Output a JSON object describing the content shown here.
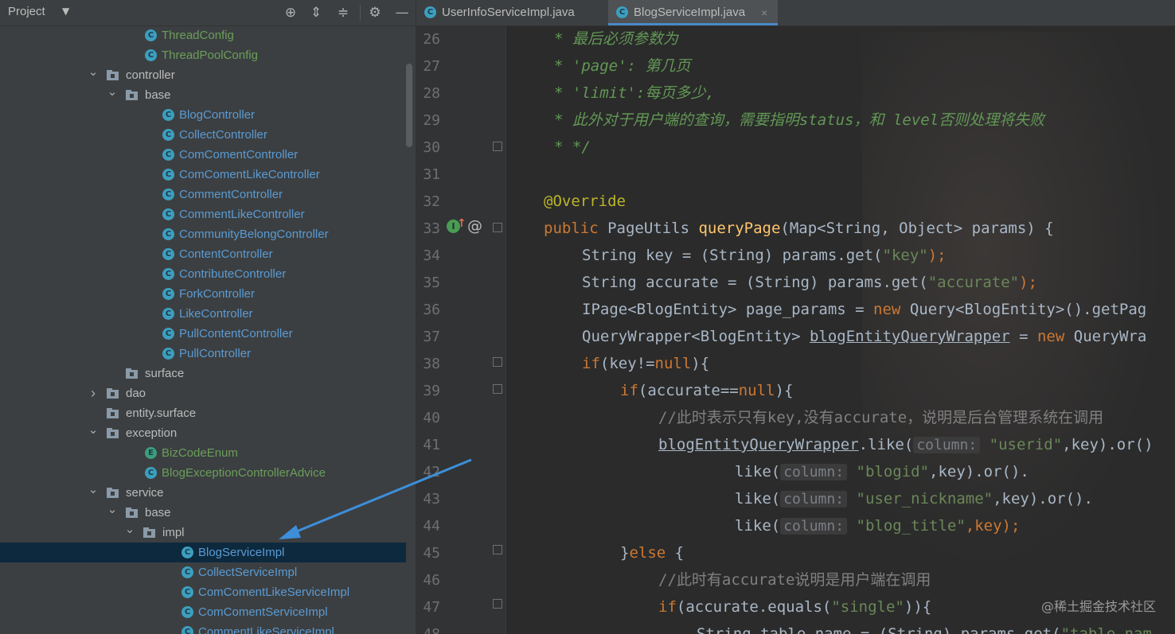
{
  "project_panel": {
    "title": "Project",
    "toolbar_icons": [
      "locate-icon",
      "expand-all-icon",
      "collapse-all-icon",
      "gear-icon",
      "minimize-icon"
    ],
    "tree": [
      {
        "label": "ThreadConfig",
        "kind": "class",
        "depth": 3
      },
      {
        "label": "ThreadPoolConfig",
        "kind": "class",
        "depth": 3
      },
      {
        "label": "controller",
        "kind": "folder",
        "depth": 2,
        "expanded": true
      },
      {
        "label": "base",
        "kind": "folder",
        "depth": 3,
        "expanded": true
      },
      {
        "label": "BlogController",
        "kind": "class",
        "depth": 4
      },
      {
        "label": "CollectController",
        "kind": "class",
        "depth": 4
      },
      {
        "label": "ComComentController",
        "kind": "class",
        "depth": 4
      },
      {
        "label": "ComComentLikeController",
        "kind": "class",
        "depth": 4
      },
      {
        "label": "CommentController",
        "kind": "class",
        "depth": 4
      },
      {
        "label": "CommentLikeController",
        "kind": "class",
        "depth": 4
      },
      {
        "label": "CommunityBelongController",
        "kind": "class",
        "depth": 4
      },
      {
        "label": "ContentController",
        "kind": "class",
        "depth": 4
      },
      {
        "label": "ContributeController",
        "kind": "class",
        "depth": 4
      },
      {
        "label": "ForkController",
        "kind": "class",
        "depth": 4
      },
      {
        "label": "LikeController",
        "kind": "class",
        "depth": 4
      },
      {
        "label": "PullContentController",
        "kind": "class",
        "depth": 4
      },
      {
        "label": "PullController",
        "kind": "class",
        "depth": 4
      },
      {
        "label": "surface",
        "kind": "folder",
        "depth": 3
      },
      {
        "label": "dao",
        "kind": "folder",
        "depth": 2,
        "expanded": false
      },
      {
        "label": "entity.surface",
        "kind": "folder",
        "depth": 2
      },
      {
        "label": "exception",
        "kind": "folder",
        "depth": 2,
        "expanded": true
      },
      {
        "label": "BizCodeEnum",
        "kind": "enum",
        "depth": 3
      },
      {
        "label": "BlogExceptionControllerAdvice",
        "kind": "class",
        "depth": 3
      },
      {
        "label": "service",
        "kind": "folder",
        "depth": 2,
        "expanded": true
      },
      {
        "label": "base",
        "kind": "folder",
        "depth": 3,
        "expanded": true
      },
      {
        "label": "impl",
        "kind": "folder",
        "depth": 4,
        "expanded": true
      },
      {
        "label": "BlogServiceImpl",
        "kind": "class",
        "depth": 5,
        "selected": true
      },
      {
        "label": "CollectServiceImpl",
        "kind": "class",
        "depth": 5
      },
      {
        "label": "ComComentLikeServiceImpl",
        "kind": "class",
        "depth": 5
      },
      {
        "label": "ComComentServiceImpl",
        "kind": "class",
        "depth": 5
      },
      {
        "label": "CommentLikeServiceImpl",
        "kind": "class",
        "depth": 5
      }
    ]
  },
  "editor": {
    "tabs": [
      {
        "label": "UserInfoServiceImpl.java",
        "active": false
      },
      {
        "label": "BlogServiceImpl.java",
        "active": true
      }
    ],
    "line_numbers": [
      "26",
      "27",
      "28",
      "29",
      "30",
      "31",
      "32",
      "33",
      "34",
      "35",
      "36",
      "37",
      "38",
      "39",
      "40",
      "41",
      "42",
      "43",
      "44",
      "45",
      "46",
      "47",
      "48"
    ],
    "code": {
      "l26": "* 最后必须参数为",
      "l27": "* 'page': 第几页",
      "l28": "* 'limit':每页多少,",
      "l29": "* 此外对于用户端的查询，需要指明status，和 level否则处理将失败",
      "l30": "* */",
      "l32": "@Override",
      "l33a": "public ",
      "l33b": "PageUtils ",
      "l33c": "queryPage",
      "l33d": "(Map<String, Object> params) {",
      "l34a": "String key = (String) params.get(",
      "l34b": "\"key\"",
      "l34c": ");",
      "l35a": "String accurate = (String) params.get(",
      "l35b": "\"accurate\"",
      "l35c": ");",
      "l36a": "IPage<BlogEntity> page_params = ",
      "l36b": "new ",
      "l36c": "Query<BlogEntity>().getPag",
      "l37a": "QueryWrapper<BlogEntity> ",
      "l37b": "blogEntityQueryWrapper",
      "l37c": " = ",
      "l37d": "new ",
      "l37e": "QueryWra",
      "l38a": "if",
      "l38b": "(key!=",
      "l38c": "null",
      "l38d": "){",
      "l39a": "if",
      "l39b": "(accurate==",
      "l39c": "null",
      "l39d": "){",
      "l40": "//此时表示只有key,没有accurate，说明是后台管理系统在调用",
      "l41a": "blogEntityQueryWrapper",
      "l41b": ".like(",
      "l41c": "column:",
      "l41d": "\"userid\"",
      "l41e": ",key).or()",
      "l42a": "like(",
      "l42b": "column:",
      "l42c": "\"blogid\"",
      "l42d": ",key).or().",
      "l43a": "like(",
      "l43b": "column:",
      "l43c": "\"user_nickname\"",
      "l43d": ",key).or().",
      "l44a": "like(",
      "l44b": "column:",
      "l44c": "\"blog_title\"",
      "l44d": ",key);",
      "l45a": "}",
      "l45b": "else ",
      "l45c": "{",
      "l46": "//此时有accurate说明是用户端在调用",
      "l47a": "if",
      "l47b": "(accurate.equals(",
      "l47c": "\"single\"",
      "l47d": ")){",
      "l48a": "String table_name = (String) params.get(",
      "l48b": "\"table_nam"
    },
    "gutter_markers": {
      "l33_override": "I↑",
      "l33_at": "@"
    }
  },
  "watermark": "@稀土掘金技术社区",
  "colors": {
    "keyword": "#cc7832",
    "string": "#6a8759",
    "comment": "#629755",
    "annotation": "#bbb529",
    "method": "#ffc66d",
    "selection": "#0d293e",
    "arrow": "#3d8fd9"
  }
}
